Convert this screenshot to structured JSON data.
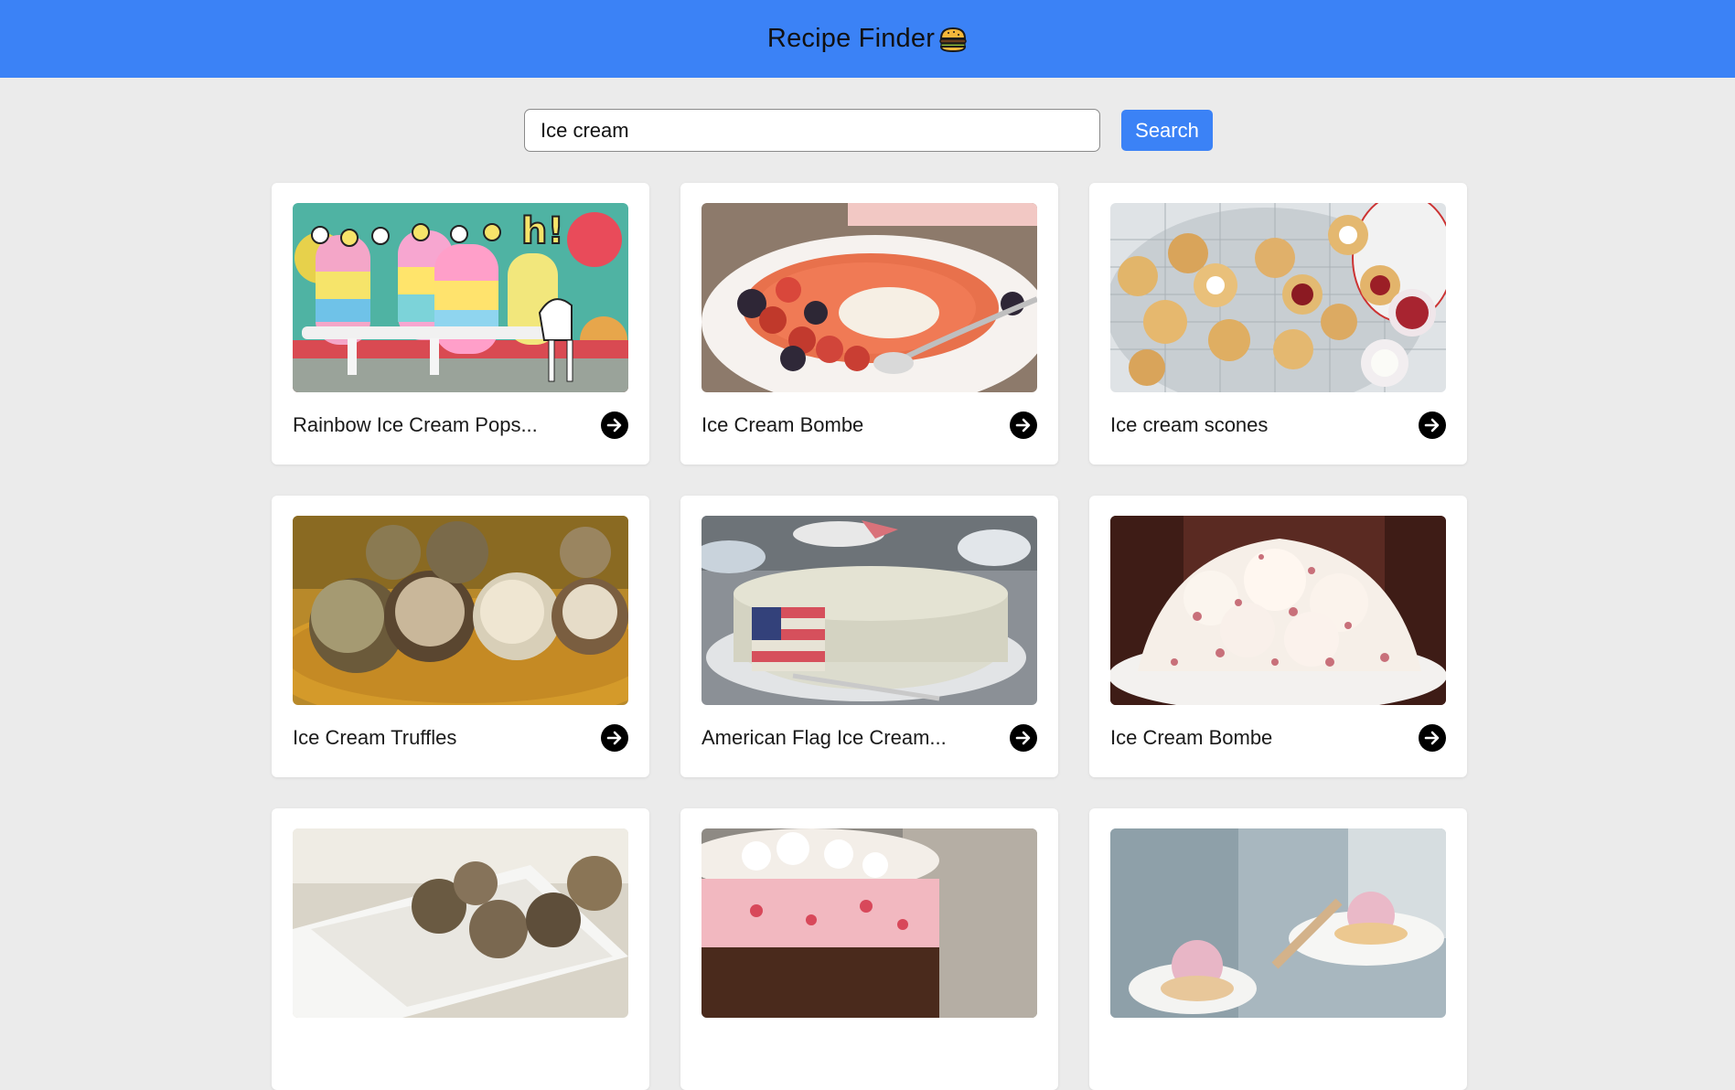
{
  "header": {
    "title": "Recipe Finder",
    "icon": "burger-icon",
    "background": "#3b82f6"
  },
  "search": {
    "value": "Ice cream",
    "placeholder": "",
    "button_label": "Search"
  },
  "recipes": [
    {
      "title": "Rainbow Ice Cream Pops...",
      "image": "rainbow-ice-cream-pops-photo"
    },
    {
      "title": "Ice Cream Bombe",
      "image": "ice-cream-bombe-berries-photo"
    },
    {
      "title": "Ice cream scones",
      "image": "ice-cream-scones-photo"
    },
    {
      "title": "Ice Cream Truffles",
      "image": "ice-cream-truffles-photo"
    },
    {
      "title": "American Flag Ice Cream...",
      "image": "american-flag-cake-photo"
    },
    {
      "title": "Ice Cream Bombe",
      "image": "peppermint-bombe-photo"
    },
    {
      "title": "",
      "image": "cookies-in-bowl-photo"
    },
    {
      "title": "",
      "image": "ice-cream-cake-slice-photo"
    },
    {
      "title": "",
      "image": "ice-cream-sundae-plate-photo"
    }
  ]
}
